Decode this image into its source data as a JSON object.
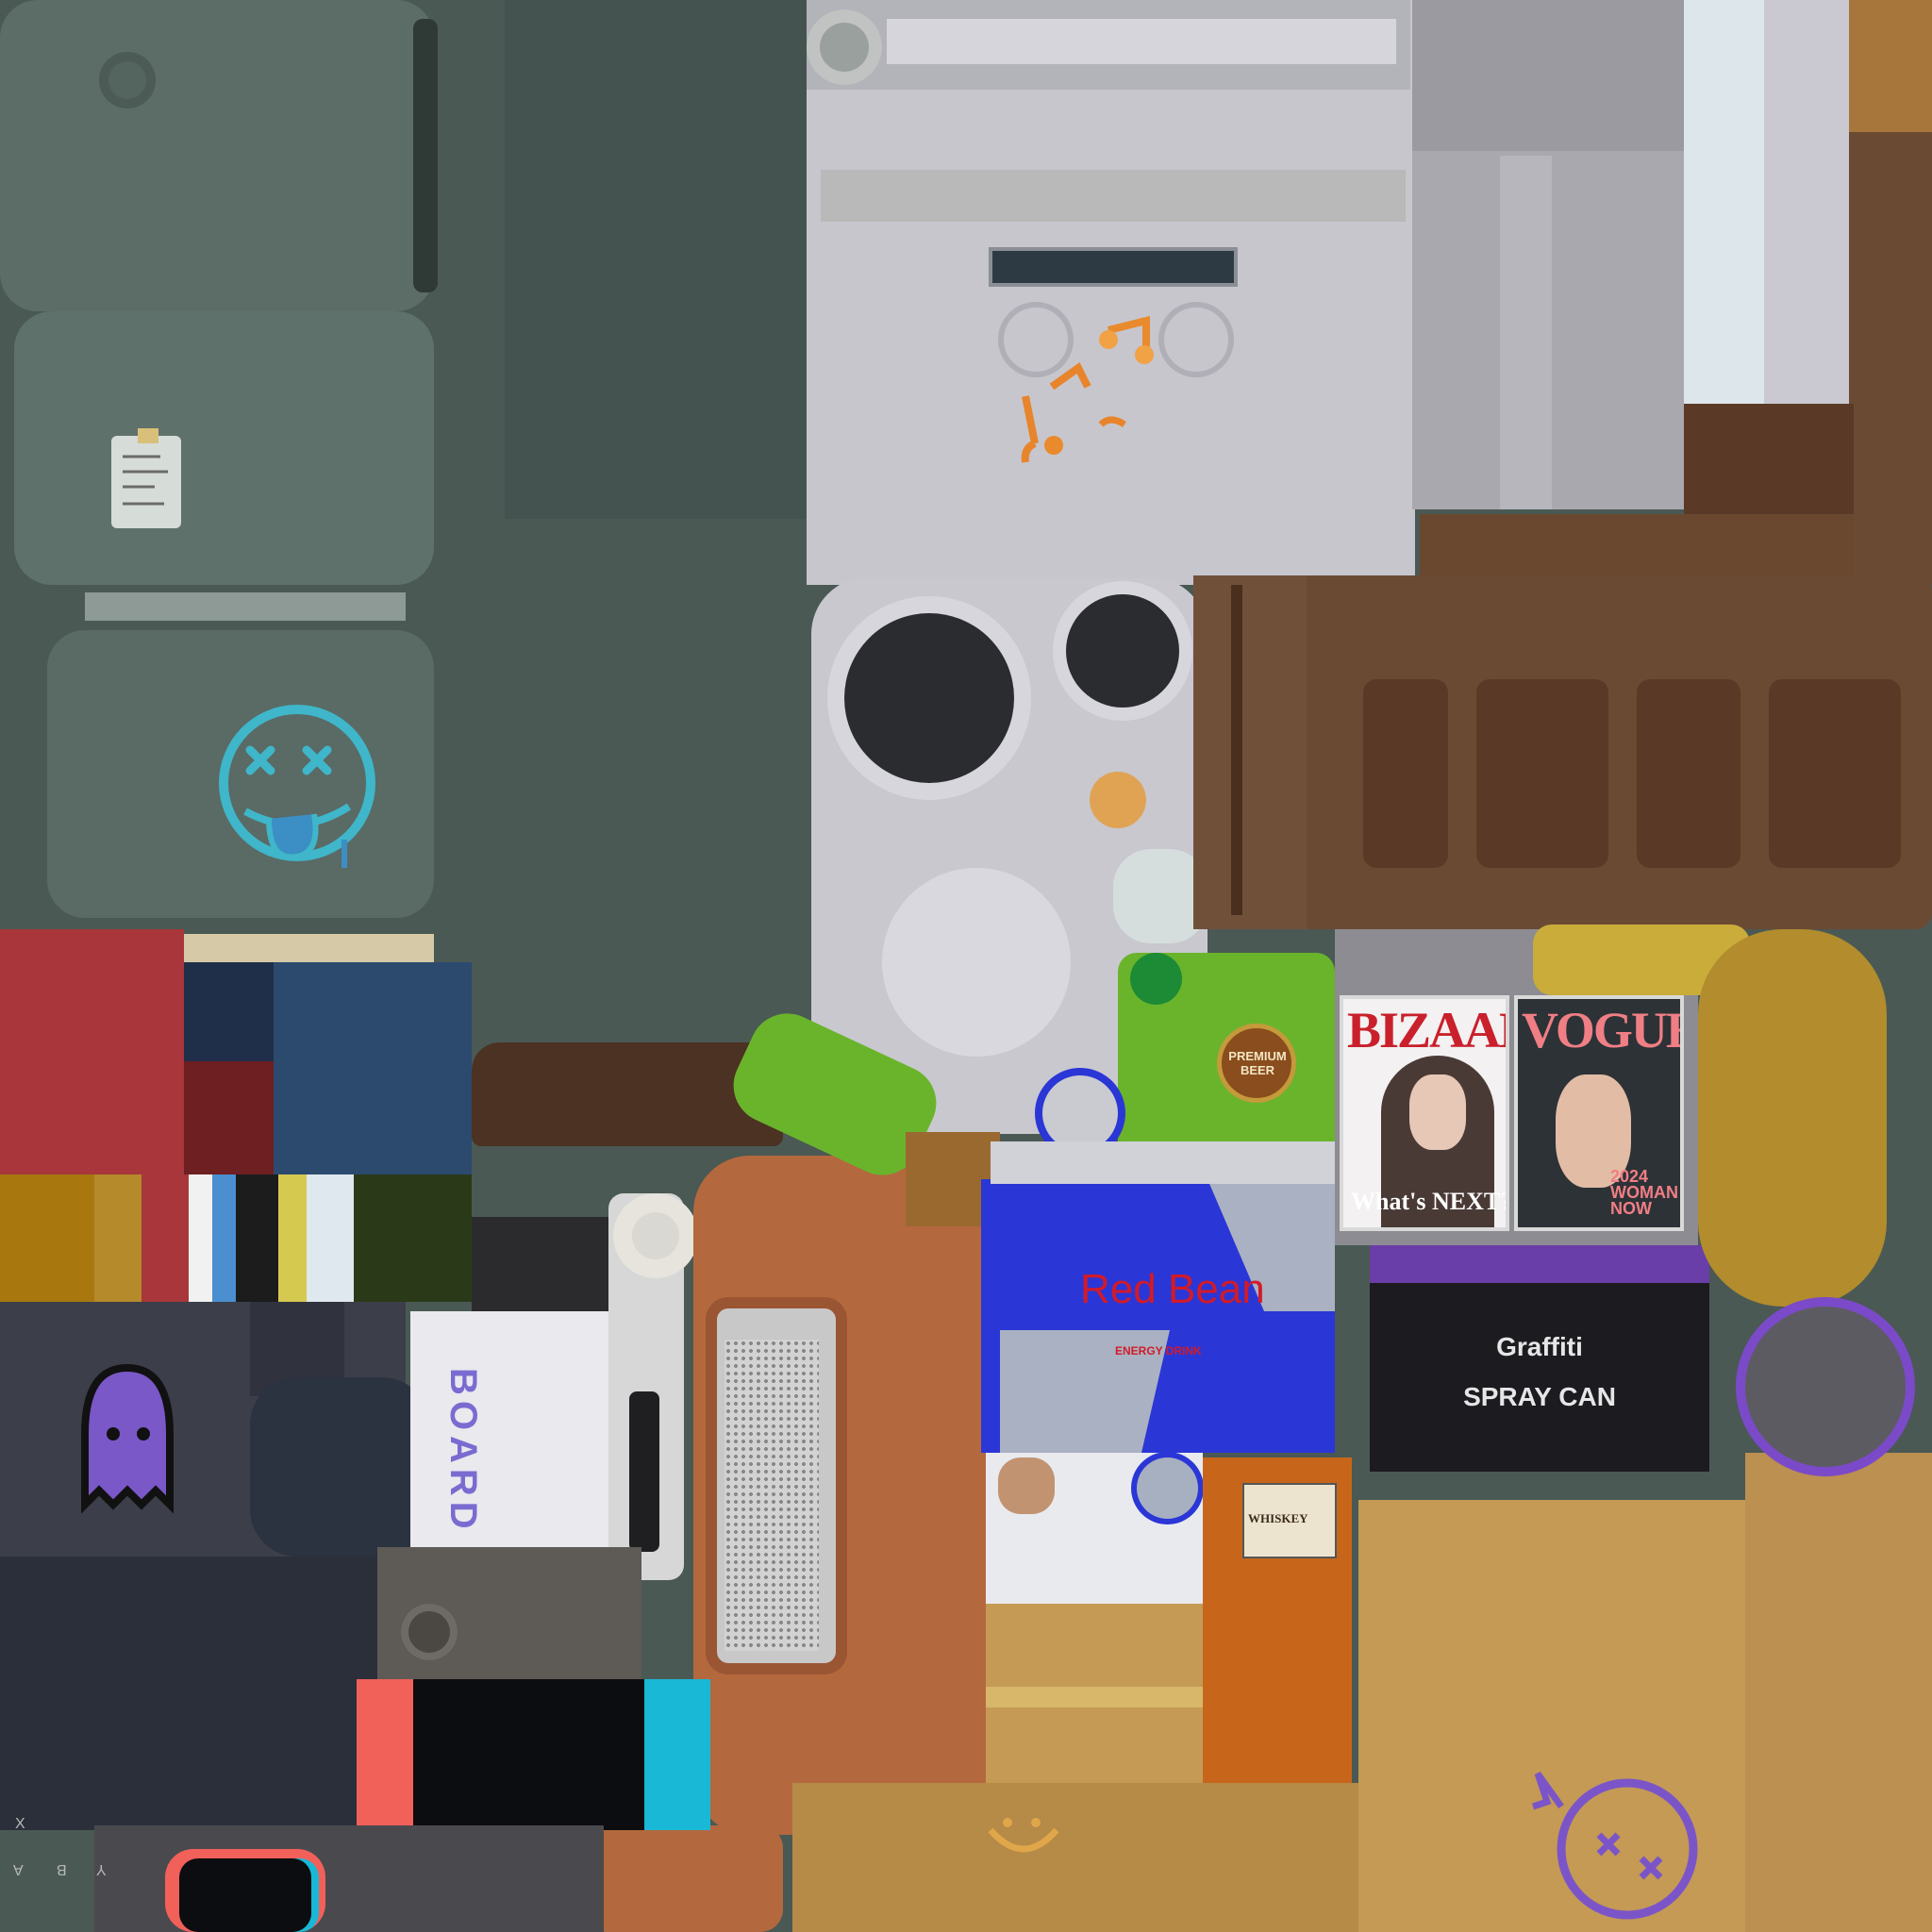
{
  "atlas": {
    "drink_can": {
      "brand": "Red Bean",
      "tagline": "ENERGY DRINK"
    },
    "spray_can": {
      "line1": "Graffiti",
      "line2": "SPRAY CAN"
    },
    "magazine_1": {
      "title": "BIZAAR",
      "cover_line": "What's NEXT?"
    },
    "magazine_2": {
      "title": "VOGUE",
      "cover_line": "2024 WOMAN NOW"
    },
    "beer_bottle": {
      "label": "PREMIUM BEER"
    },
    "whiskey_bottle": {
      "label": "WHISKEY"
    },
    "skateboard": {
      "label": "BOARD"
    },
    "controller_buttons": [
      "X",
      "A",
      "B",
      "Y"
    ],
    "colors": {
      "fridge_green": "#5f716b",
      "appliance_grey": "#c9c8cf",
      "wood_brown": "#6b4a33",
      "can_blue": "#2b36d6",
      "can_red_text": "#d11b2a",
      "bottle_green": "#6ab42c",
      "cardboard": "#c49a55",
      "graffiti_purple": "#6a3ea8",
      "cyan_accent": "#19b8d6",
      "coral_accent": "#f2605a"
    }
  }
}
